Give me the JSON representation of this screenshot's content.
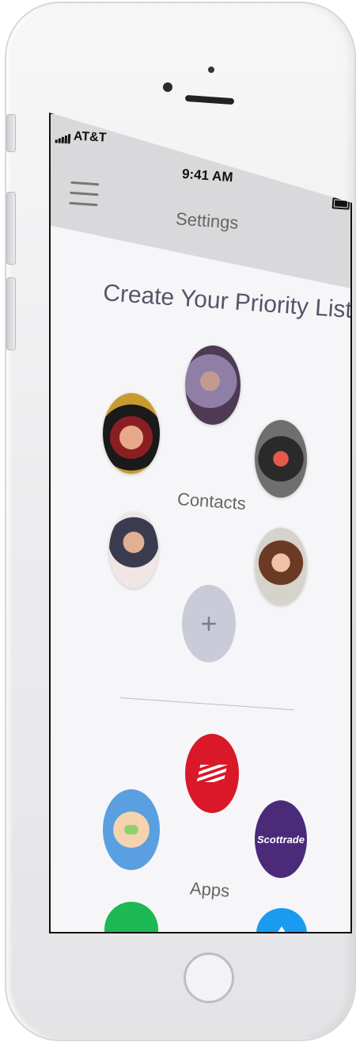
{
  "status_bar": {
    "carrier": "AT&T",
    "time": "9:41 AM"
  },
  "nav": {
    "title": "Settings",
    "menu_icon": "hamburger-menu-icon"
  },
  "page": {
    "title": "Create Your Priority List"
  },
  "contacts": {
    "label": "Contacts",
    "add_symbol": "+",
    "avatars": [
      "contact-avatar",
      "contact-avatar",
      "contact-avatar",
      "contact-avatar",
      "contact-avatar"
    ]
  },
  "apps": {
    "label": "Apps",
    "items": [
      {
        "icon": "bank-of-america-icon",
        "color": "#d9182a"
      },
      {
        "icon": "baby-app-icon",
        "color": "#5aa0e0"
      },
      {
        "icon": "scottrade-icon",
        "color": "#4b2a7a",
        "text": "Scottrade"
      },
      {
        "icon": "spotify-icon",
        "color": "#1db954"
      },
      {
        "icon": "blue-arrow-app-icon",
        "color": "#1a9bf0"
      }
    ]
  }
}
